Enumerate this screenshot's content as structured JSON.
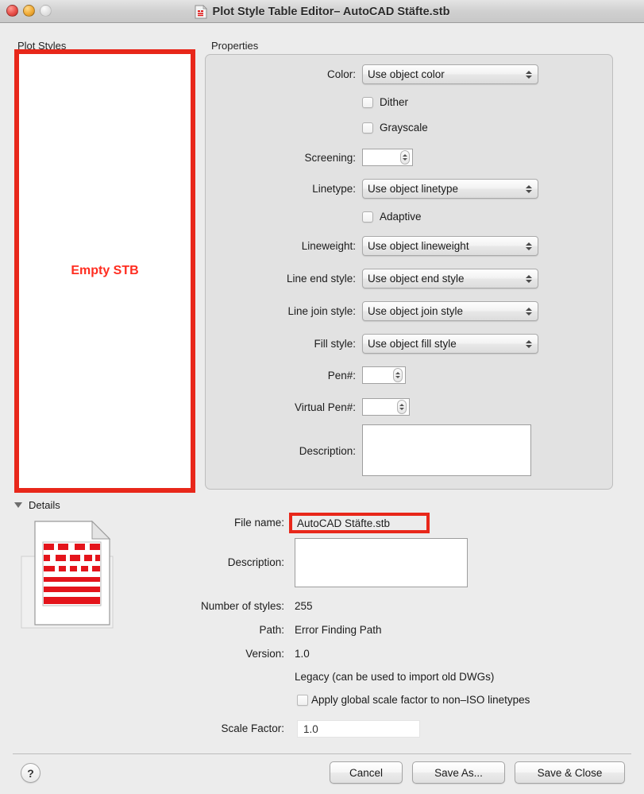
{
  "window": {
    "title": "Plot Style Table Editor– AutoCAD Stäfte.stb",
    "icon": "stb-document-icon",
    "controls": {
      "close": "close-button",
      "minimize": "minimize-button",
      "zoom": "zoom-button"
    }
  },
  "plot_styles": {
    "label": "Plot Styles",
    "annotation": "Empty STB",
    "items": [],
    "annotation_color": "#ff2d20",
    "highlight_color": "#e8271a"
  },
  "properties": {
    "label": "Properties",
    "color": {
      "label": "Color:",
      "value": "Use object color"
    },
    "dither": {
      "label": "Dither",
      "checked": false
    },
    "grayscale": {
      "label": "Grayscale",
      "checked": false
    },
    "screening": {
      "label": "Screening:",
      "value": ""
    },
    "linetype": {
      "label": "Linetype:",
      "value": "Use object linetype"
    },
    "adaptive": {
      "label": "Adaptive",
      "checked": false
    },
    "lineweight": {
      "label": "Lineweight:",
      "value": "Use object lineweight"
    },
    "line_end_style": {
      "label": "Line end style:",
      "value": "Use object end style"
    },
    "line_join_style": {
      "label": "Line join style:",
      "value": "Use object join style"
    },
    "fill_style": {
      "label": "Fill style:",
      "value": "Use object fill style"
    },
    "pen": {
      "label": "Pen#:",
      "value": ""
    },
    "virtual_pen": {
      "label": "Virtual Pen#:",
      "value": ""
    },
    "description": {
      "label": "Description:",
      "value": ""
    }
  },
  "details": {
    "label": "Details",
    "file_name": {
      "label": "File name:",
      "value": "AutoCAD Stäfte.stb"
    },
    "description": {
      "label": "Description:",
      "value": ""
    },
    "number_of_styles": {
      "label": "Number of styles:",
      "value": "255"
    },
    "path": {
      "label": "Path:",
      "value": "Error Finding Path"
    },
    "version": {
      "label": "Version:",
      "value": "1.0"
    },
    "legacy_note": "Legacy (can be used to import old DWGs)",
    "apply_global_scale": {
      "label": "Apply global scale factor to non–ISO linetypes",
      "checked": false
    },
    "scale_factor": {
      "label": "Scale Factor:",
      "value": "1.0"
    }
  },
  "footer": {
    "help": "?",
    "cancel": "Cancel",
    "save_as": "Save As...",
    "save_and_close": "Save & Close"
  }
}
